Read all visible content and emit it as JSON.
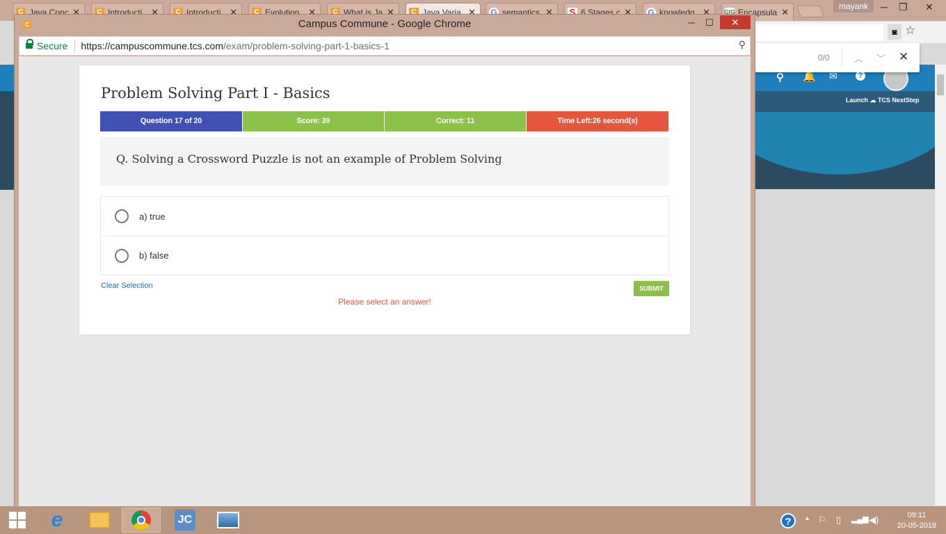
{
  "browser_tabs": [
    {
      "title": "Java Conc",
      "icon": "c-icon"
    },
    {
      "title": "Introducti",
      "icon": "c-icon"
    },
    {
      "title": "Introducti",
      "icon": "c-icon"
    },
    {
      "title": "Evolution",
      "icon": "c-icon"
    },
    {
      "title": "What is Ja",
      "icon": "c-icon"
    },
    {
      "title": "Java Varia",
      "icon": "c-icon"
    },
    {
      "title": "semantics",
      "icon": "google-icon"
    },
    {
      "title": "6 Stages c",
      "icon": "s-icon"
    },
    {
      "title": "knowledg",
      "icon": "google-icon"
    },
    {
      "title": "Encapsula",
      "icon": "gfg-icon"
    }
  ],
  "profile_user": "mayank",
  "find_bar": {
    "count": "0/0"
  },
  "background_page": {
    "launch_label": "Launch",
    "launch_brand": "TCS NextStep"
  },
  "popup": {
    "window_title": "Campus Commune - Google Chrome",
    "secure_label": "Secure",
    "url_host": "https://campuscommune.tcs.com",
    "url_path": "/exam/problem-solving-part-1-basics-1"
  },
  "quiz": {
    "title": "Problem Solving Part I - Basics",
    "stats": {
      "question": "Question 17 of 20",
      "score": "Score: 39",
      "correct": "Correct: 11",
      "time_left": "Time Left:26 second(s)"
    },
    "question": "Q. Solving a Crossword Puzzle is not an example of Problem Solving",
    "options": [
      "a) true",
      "b) false"
    ],
    "clear_label": "Clear Selection",
    "submit_label": "SUBMIT",
    "warning": "Please select an answer!"
  },
  "colors": {
    "question_stat": "#3f51b5",
    "score_stat": "#8bc34a",
    "correct_stat": "#8bc34a",
    "time_stat": "#e6553e"
  },
  "taskbar": {
    "time": "09:11",
    "date": "20-05-2018"
  }
}
